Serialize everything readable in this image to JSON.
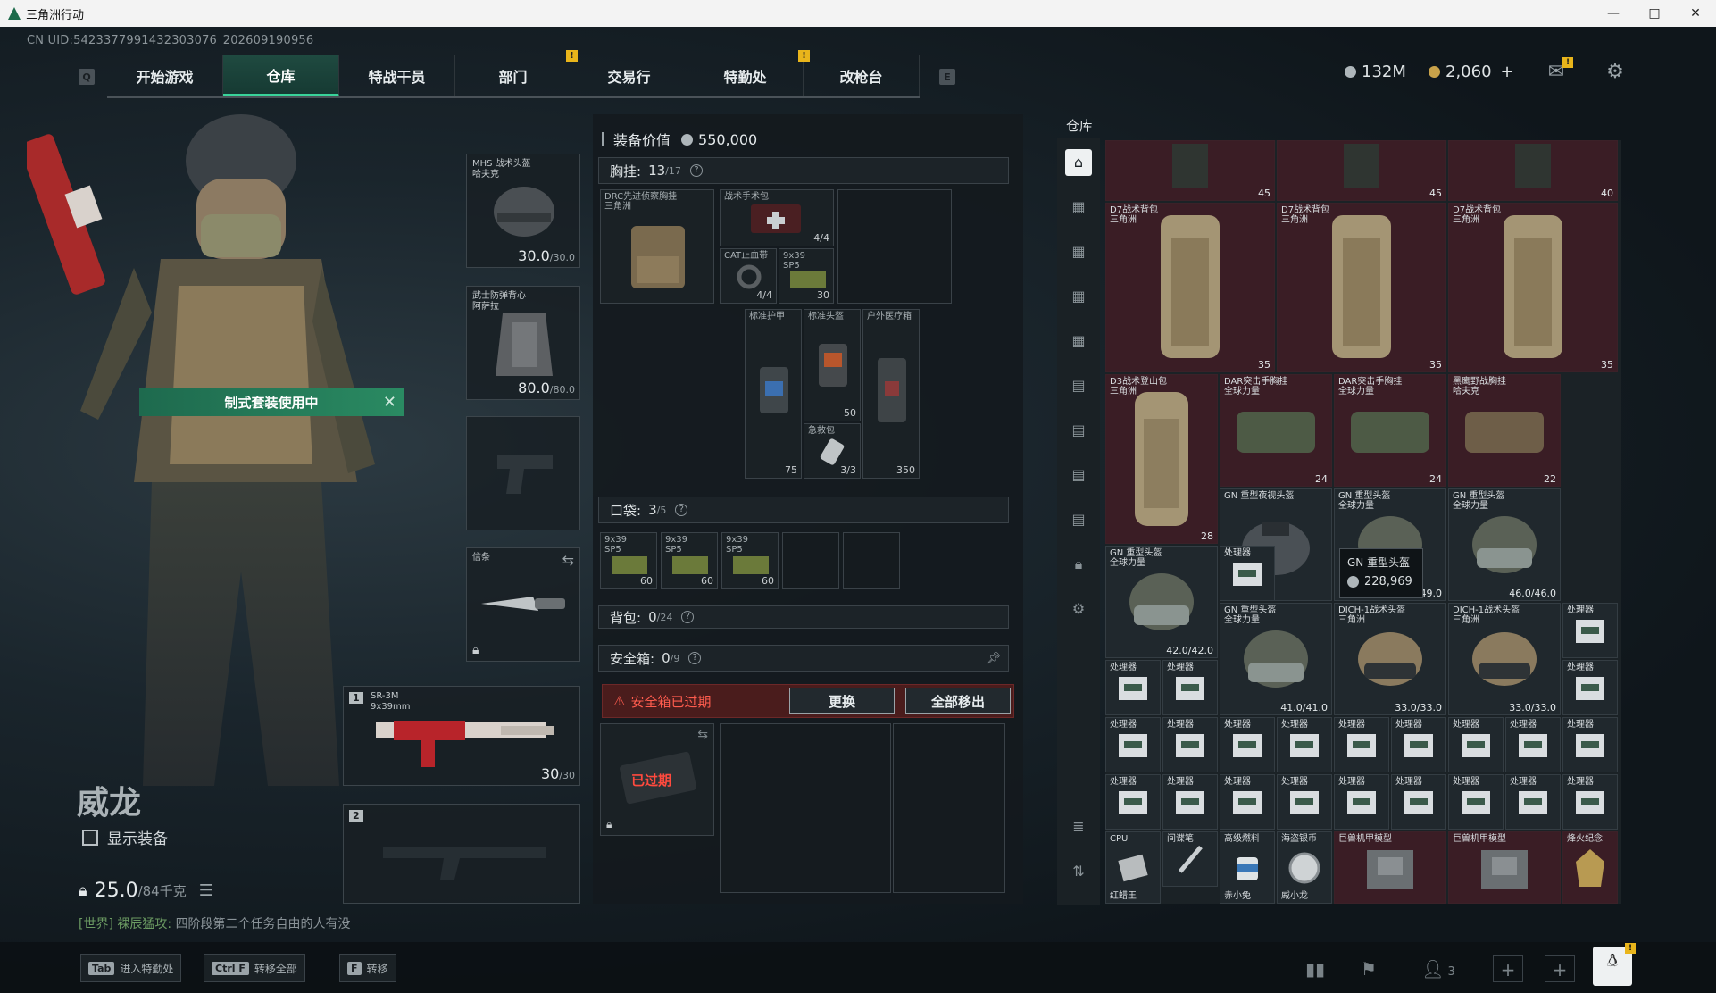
{
  "window": {
    "title": "三角洲行动",
    "controls": [
      "—",
      "□",
      "✕"
    ]
  },
  "uid": "CN UID:5423377991432303076_202609190956",
  "nav": {
    "left_key": "Q",
    "right_key": "E",
    "tabs": [
      {
        "label": "开始游戏",
        "active": false,
        "warn": false
      },
      {
        "label": "仓库",
        "active": true,
        "warn": false
      },
      {
        "label": "特战干员",
        "active": false,
        "warn": false
      },
      {
        "label": "部门",
        "active": false,
        "warn": true
      },
      {
        "label": "交易行",
        "active": false,
        "warn": false
      },
      {
        "label": "特勤处",
        "active": false,
        "warn": true
      },
      {
        "label": "改枪台",
        "active": false,
        "warn": false
      }
    ],
    "warn_mark": "!"
  },
  "currency": {
    "silver": "132M",
    "gold": "2,060",
    "plus": "+"
  },
  "character": {
    "kit_banner": "制式套装使用中",
    "name": "威龙",
    "show_equipment": "显示装备",
    "weight": "25.0",
    "weight_max": "/84千克",
    "chat_channel": "[世界]",
    "chat_user": "裸辰猛攻:",
    "chat_msg": "四阶段第二个任务自由的人有没"
  },
  "loadout": {
    "helmet": {
      "label": "MHS 战术头盔\n哈夫克",
      "dur": "30.0",
      "max": "/30.0"
    },
    "armor": {
      "label": "武士防弹背心\n阿萨拉",
      "dur": "80.0",
      "max": "/80.0"
    },
    "melee": {
      "label": "信条"
    },
    "primary": {
      "slot": "1",
      "label": "SR-3M\n9x39mm",
      "ammo": "30",
      "max": "/30"
    },
    "secondary": {
      "slot": "2"
    }
  },
  "equip": {
    "header": "装备价值",
    "value": "550,000",
    "chest": {
      "label": "胸挂:",
      "num": "13",
      "max": "/17",
      "q": "?"
    },
    "chest_items": [
      {
        "label": "DRC先进侦察胸挂\n三角洲",
        "cnt": ""
      },
      {
        "label": "战术手术包",
        "cnt": "4/4"
      },
      {
        "label": "CAT止血带",
        "cnt": "4/4"
      },
      {
        "label": "9x39\nSP5",
        "cnt": "30"
      },
      {
        "label": "标准护甲",
        "cnt": "75"
      },
      {
        "label": "标准头盔",
        "cnt": "50"
      },
      {
        "label": "户外医疗箱",
        "cnt": "350"
      },
      {
        "label": "急救包",
        "cnt": "3/3"
      }
    ],
    "pocket": {
      "label": "口袋:",
      "num": "3",
      "max": "/5",
      "q": "?"
    },
    "pocket_items": [
      {
        "label": "9x39\nSP5",
        "cnt": "60"
      },
      {
        "label": "9x39\nSP5",
        "cnt": "60"
      },
      {
        "label": "9x39\nSP5",
        "cnt": "60"
      }
    ],
    "backpack": {
      "label": "背包:",
      "num": "0",
      "max": "/24",
      "q": "?"
    },
    "safebox": {
      "label": "安全箱:",
      "num": "0",
      "max": "/9",
      "q": "?"
    },
    "expired_warning": "安全箱已过期",
    "replace_btn": "更换",
    "move_all_btn": "全部移出",
    "expired_tag": "已过期"
  },
  "stash": {
    "title": "仓库",
    "tooltip": {
      "name": "GN 重型头盔",
      "price": "228,969"
    },
    "items": [
      {
        "label": "",
        "cnt": "45"
      },
      {
        "label": "",
        "cnt": "45"
      },
      {
        "label": "",
        "cnt": "40"
      },
      {
        "label": "D7战术背包\n三角洲",
        "cnt": "35"
      },
      {
        "label": "D7战术背包\n三角洲",
        "cnt": "35"
      },
      {
        "label": "D7战术背包\n三角洲",
        "cnt": "35"
      },
      {
        "label": "D3战术登山包\n三角洲",
        "cnt": "28"
      },
      {
        "label": "DAR突击手胸挂\n全球力量",
        "cnt": "24"
      },
      {
        "label": "DAR突击手胸挂\n全球力量",
        "cnt": "24"
      },
      {
        "label": "黑鹰野战胸挂\n哈夫克",
        "cnt": "22"
      },
      {
        "label": "GN 重型夜视头盔",
        "cnt": ""
      },
      {
        "label": "GN 重型头盔\n全球力量",
        "cnt": "49.0/49.0"
      },
      {
        "label": "GN 重型头盔\n全球力量",
        "cnt": "46.0/46.0"
      },
      {
        "label": "GN 重型头盔\n全球力量",
        "cnt": "42.0/42.0"
      },
      {
        "label": "处理器",
        "cnt": ""
      },
      {
        "label": "GN 重型头盔\n全球力量",
        "cnt": "41.0/41.0"
      },
      {
        "label": "DICH-1战术头盔\n三角洲",
        "cnt": "33.0/33.0"
      },
      {
        "label": "DICH-1战术头盔\n三角洲",
        "cnt": "33.0/33.0"
      },
      {
        "label": "处理器",
        "cnt": ""
      },
      {
        "label": "处理器",
        "cnt": ""
      },
      {
        "label": "处理器",
        "cnt": ""
      },
      {
        "label": "处理器",
        "cnt": ""
      },
      {
        "label": "CPU",
        "cnt": ""
      },
      {
        "label": "间谍笔",
        "cnt": ""
      },
      {
        "label": "高级燃料",
        "cnt": ""
      },
      {
        "label": "海盗银币",
        "cnt": ""
      },
      {
        "label": "巨兽机甲模型",
        "cnt": ""
      },
      {
        "label": "巨兽机甲模型",
        "cnt": ""
      },
      {
        "label": "烽火纪念",
        "cnt": ""
      }
    ],
    "proc_label": "处理器",
    "bottom_labels": [
      "红蜡王",
      "赤小兔",
      "威小龙"
    ]
  },
  "bottombar": {
    "keys": [
      {
        "key": "Tab",
        "label": "进入特勤处"
      },
      {
        "key": "Ctrl  F",
        "label": "转移全部"
      },
      {
        "key": "F",
        "label": "转移"
      }
    ],
    "friends": "3"
  }
}
